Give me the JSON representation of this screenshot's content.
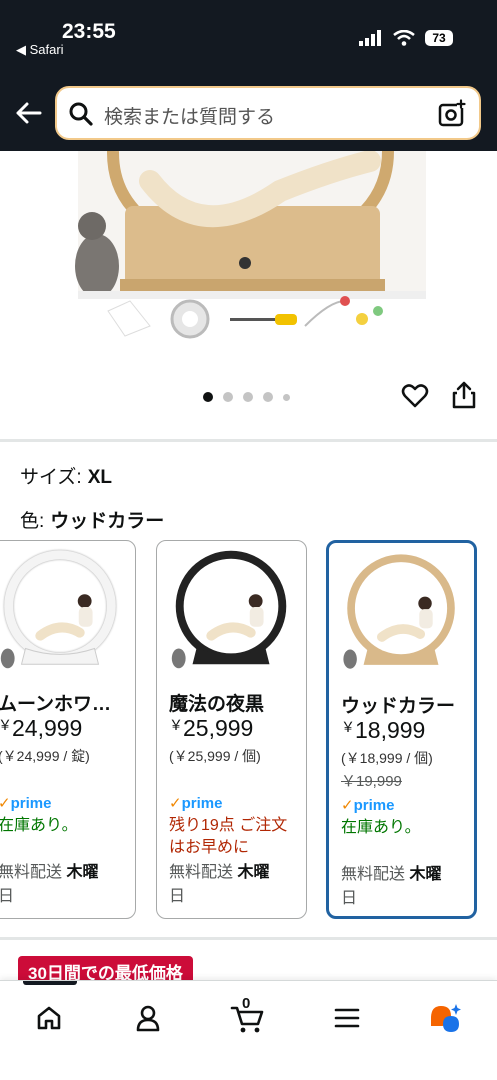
{
  "status_bar": {
    "time": "23:55",
    "back_app": "◀ Safari",
    "battery": "73"
  },
  "search": {
    "placeholder": "検索または質問する"
  },
  "carousel": {
    "dot_count": 5,
    "active_index": 0
  },
  "selection": {
    "size_label": "サイズ:",
    "size_value": "XL",
    "color_label": "色:",
    "color_value": "ウッドカラー"
  },
  "variations": [
    {
      "name": "ムーンホワ…",
      "price_symbol": "￥",
      "price": "24,999",
      "unit": "(￥24,999 / 錠)",
      "old_price": "",
      "prime": "prime",
      "stock": "在庫あり。",
      "stock_type": "ok",
      "ship_prefix": "無料配送 ",
      "ship_day": "木曜",
      "ship_suffix": "日",
      "wheel_color": "#f4f4f4"
    },
    {
      "name": "魔法の夜黒",
      "price_symbol": "￥",
      "price": "25,999",
      "unit": "(￥25,999 / 個)",
      "old_price": "",
      "prime": "prime",
      "stock": "残り19点 ご注文はお早めに",
      "stock_type": "low",
      "ship_prefix": "無料配送 ",
      "ship_day": "木曜",
      "ship_suffix": "日",
      "wheel_color": "#222222"
    },
    {
      "name": "ウッドカラー",
      "price_symbol": "￥",
      "price": "18,999",
      "unit": "(￥18,999 / 個)",
      "old_price": "￥19,999",
      "prime": "prime",
      "stock": "在庫あり。",
      "stock_type": "ok",
      "ship_prefix": "無料配送 ",
      "ship_day": "木曜",
      "ship_suffix": "日",
      "wheel_color": "#d9b98a"
    }
  ],
  "deal_badge": "30日間での最低価格",
  "bottom_nav": {
    "cart_count": "0",
    "items": [
      "home",
      "account",
      "cart",
      "menu",
      "rufus"
    ]
  }
}
